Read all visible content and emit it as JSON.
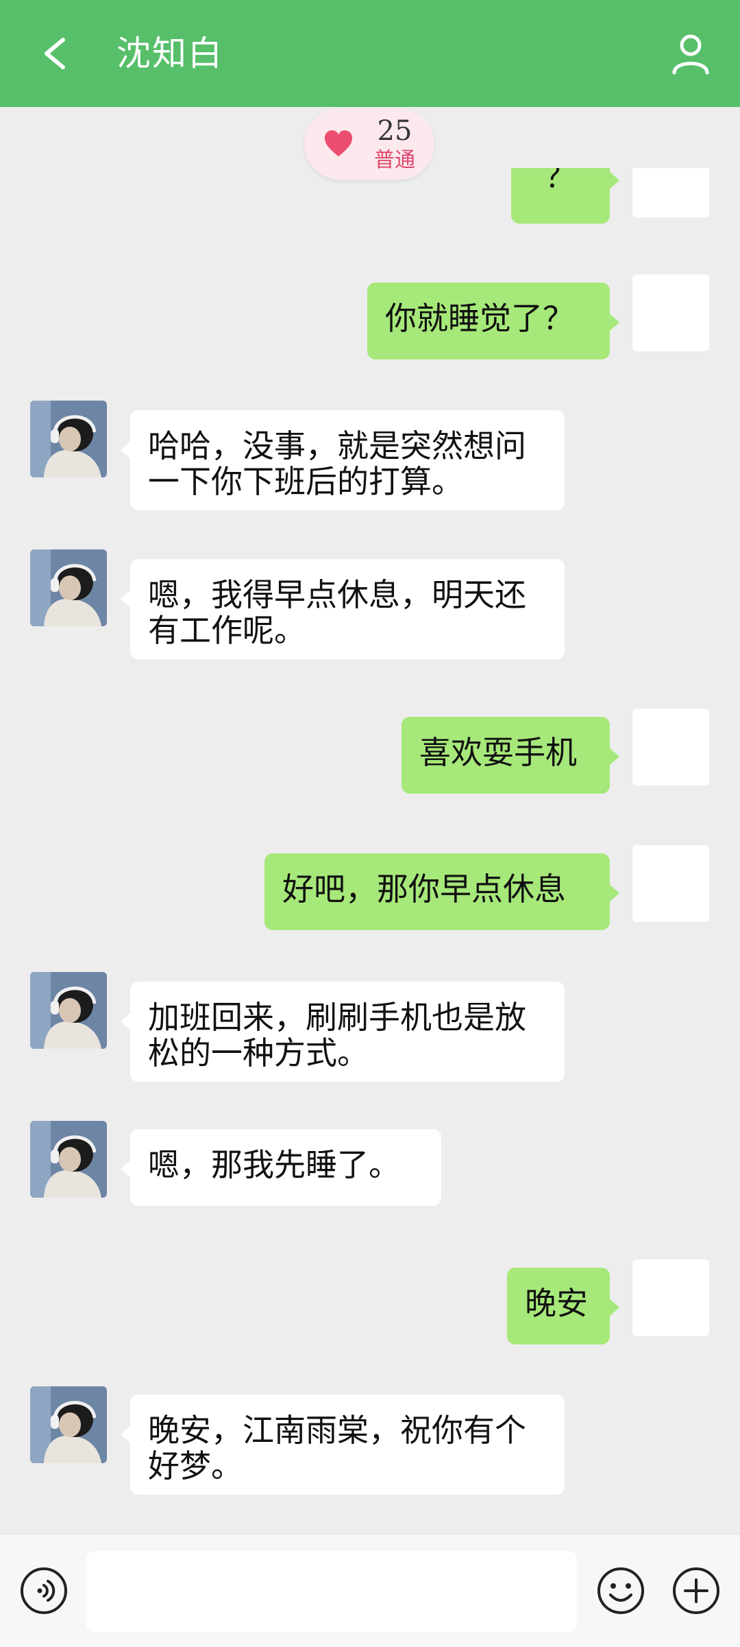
{
  "header": {
    "title": "沈知白"
  },
  "badge": {
    "score": "25",
    "level": "普通",
    "heart_color": "#ec4e6f"
  },
  "theme": {
    "header_color": "#57bf6a",
    "my_bubble_color": "#a6e879",
    "other_bubble_color": "#ffffff",
    "background": "#ededed"
  },
  "messages": [
    {
      "sender": "me",
      "text": "？"
    },
    {
      "sender": "me",
      "text": "你就睡觉了？"
    },
    {
      "sender": "other",
      "text": "哈哈，没事，就是突然想问一下你下班后的打算。"
    },
    {
      "sender": "other",
      "text": "嗯，我得早点休息，明天还有工作呢。"
    },
    {
      "sender": "me",
      "text": "喜欢耍手机"
    },
    {
      "sender": "me",
      "text": "好吧，那你早点休息"
    },
    {
      "sender": "other",
      "text": "加班回来，刷刷手机也是放松的一种方式。"
    },
    {
      "sender": "other",
      "text": "嗯，那我先睡了。"
    },
    {
      "sender": "me",
      "text": "晚安"
    },
    {
      "sender": "other",
      "text": "晚安，江南雨棠，祝你有个好梦。"
    }
  ],
  "input": {
    "value": "",
    "placeholder": ""
  },
  "icons": {
    "back": "chevron-left-icon",
    "profile": "person-icon",
    "voice": "voice-icon",
    "emoji": "emoji-icon",
    "more": "plus-circle-icon"
  }
}
